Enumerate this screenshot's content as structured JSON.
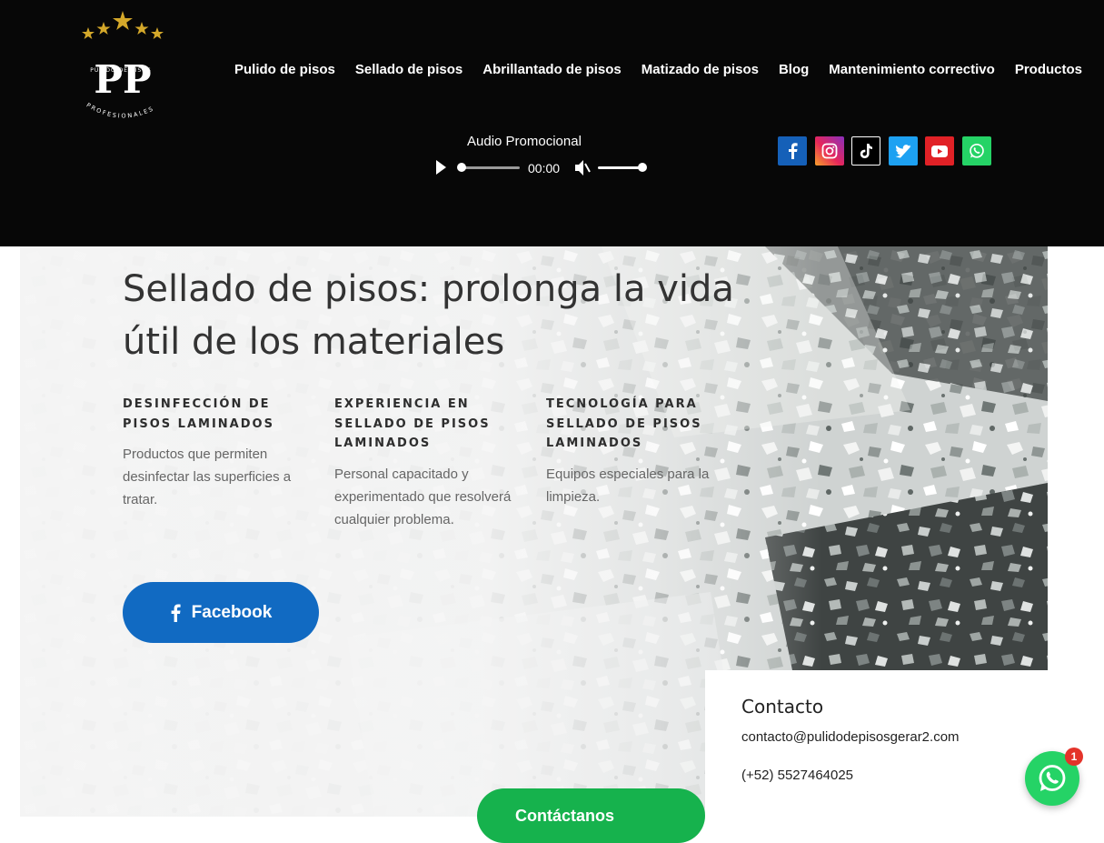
{
  "header": {
    "logo": {
      "name": "pp-logo",
      "text_main": "PP",
      "text_top": "PULIDO DE PISOS",
      "text_bottom": "PROFESIONALES"
    },
    "nav": [
      {
        "label": "Pulido de pisos"
      },
      {
        "label": "Sellado de pisos"
      },
      {
        "label": "Abrillantado de pisos"
      },
      {
        "label": "Matizado de pisos"
      },
      {
        "label": "Blog"
      },
      {
        "label": "Mantenimiento correctivo"
      },
      {
        "label": "Productos"
      }
    ],
    "audio": {
      "title": "Audio Promocional",
      "time": "00:00",
      "progress": 0,
      "volume": 1.0
    },
    "socials": [
      {
        "icon": "facebook-icon"
      },
      {
        "icon": "instagram-icon"
      },
      {
        "icon": "tiktok-icon"
      },
      {
        "icon": "twitter-icon"
      },
      {
        "icon": "youtube-icon"
      },
      {
        "icon": "whatsapp-icon"
      }
    ]
  },
  "hero": {
    "title": "Sellado de pisos: prolonga la vida útil de los materiales",
    "features": [
      {
        "heading": "DESINFECCIÓN DE PISOS LAMINADOS",
        "text": "Productos que permiten desinfectar las superficies a tratar."
      },
      {
        "heading": "EXPERIENCIA EN SELLADO DE PISOS LAMINADOS",
        "text": "Personal capacitado y experimentado que resolverá cualquier problema."
      },
      {
        "heading": "TECNOLOGÍA PARA SELLADO DE PISOS LAMINADOS",
        "text": "Equipos especiales para la limpieza."
      }
    ],
    "facebook_button": "Facebook",
    "contact_button": "Contáctanos"
  },
  "contact": {
    "title": "Contacto",
    "email": "contacto@pulidodepisosgerar2.com",
    "phone": "(+52) 5527464025"
  },
  "whatsapp_float": {
    "badge": "1"
  },
  "colors": {
    "header_bg": "#070707",
    "facebook_blue": "#116ac2",
    "whatsapp_green": "#25d366",
    "contact_green": "#16b24d",
    "badge_red": "#e4332a",
    "gold": "#d4a82a"
  }
}
